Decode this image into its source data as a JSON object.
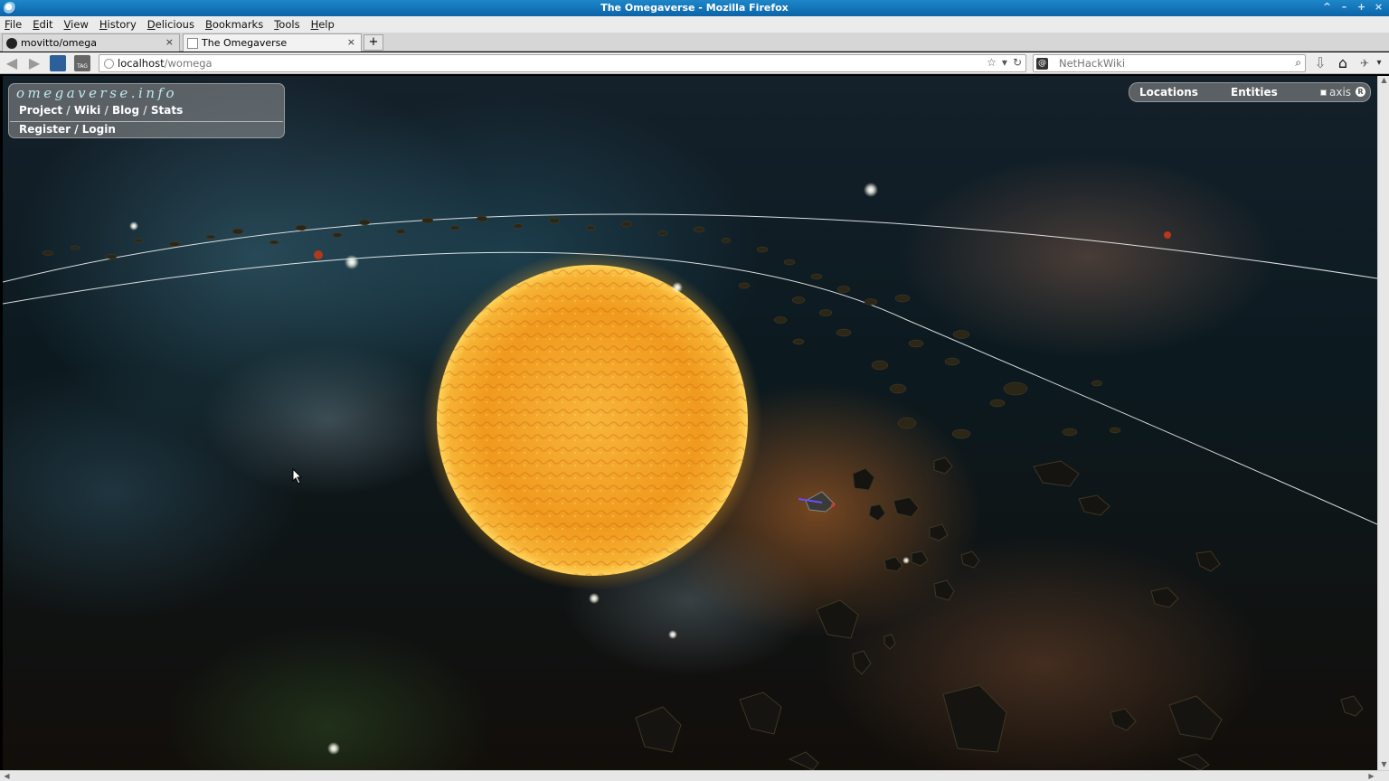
{
  "window": {
    "title": "The Omegaverse - Mozilla Firefox",
    "controls": [
      "^",
      "–",
      "+",
      "×"
    ]
  },
  "menu": [
    "File",
    "Edit",
    "View",
    "History",
    "Delicious",
    "Bookmarks",
    "Tools",
    "Help"
  ],
  "tabs": [
    {
      "label": "movitto/omega",
      "close": "×",
      "icon": "github-icon"
    },
    {
      "label": "The Omegaverse",
      "close": "×",
      "icon": "page-icon"
    }
  ],
  "new_tab_label": "+",
  "url": {
    "host": "localhost",
    "path": "/womega"
  },
  "search": {
    "placeholder": "NetHackWiki",
    "engine_icon": "nethackwiki-icon"
  },
  "site": {
    "title": "omegaverse.info",
    "links": [
      "Project",
      "Wiki",
      "Blog",
      "Stats"
    ],
    "link_separator": " / ",
    "auth": [
      "Register",
      "Login"
    ]
  },
  "scene_nav": {
    "locations": "Locations",
    "entities": "Entities",
    "axis_label": "axis",
    "axis_checked": false,
    "reset_icon": "R"
  },
  "colors": {
    "title_bar": "#1779bd",
    "site_title": "#bfe9f2",
    "sun_core": "#f4a82a",
    "orbit_line": "#ffffff"
  }
}
